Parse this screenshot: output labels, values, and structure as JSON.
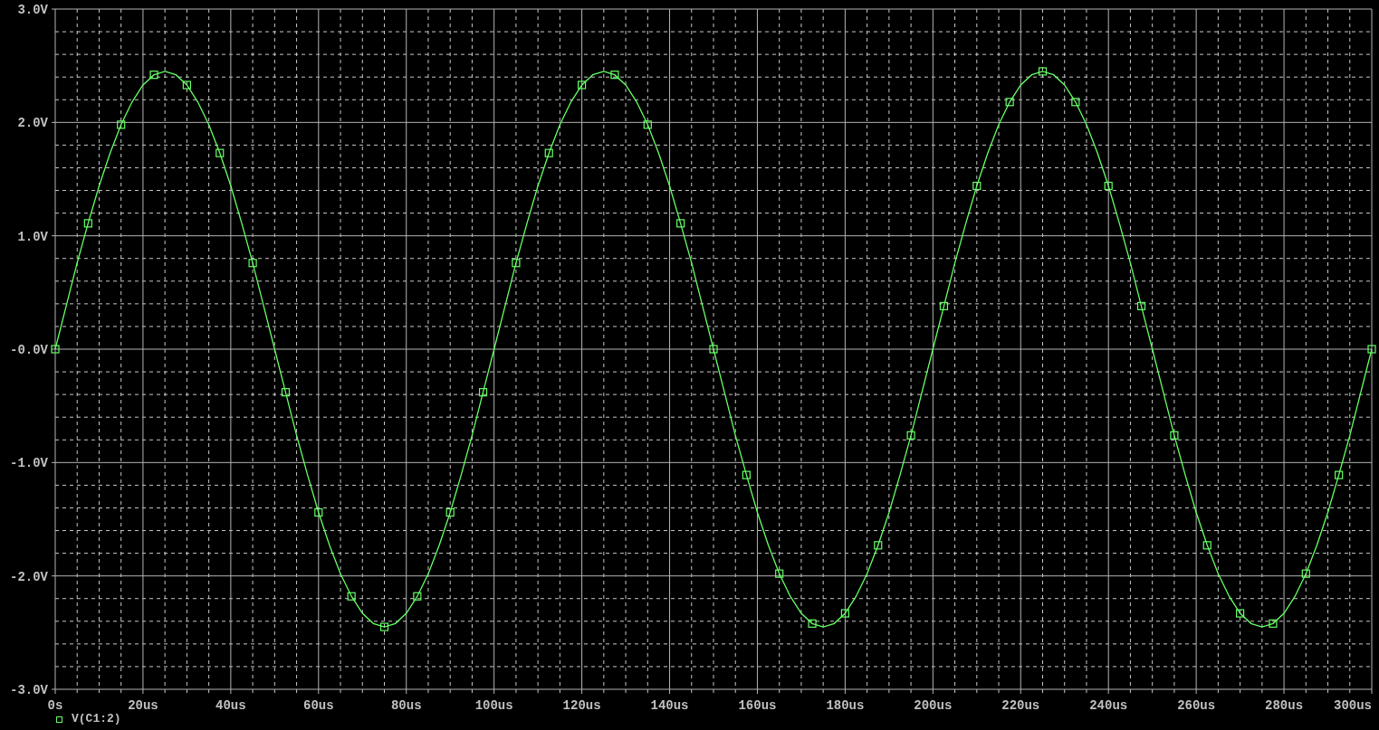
{
  "plot": {
    "chart_data": {
      "type": "line",
      "grid": true,
      "xlim": [
        0,
        300
      ],
      "ylim": [
        -3,
        3
      ],
      "xticks": [
        {
          "value": 0,
          "label": "0s"
        },
        {
          "value": 20,
          "label": "20us"
        },
        {
          "value": 40,
          "label": "40us"
        },
        {
          "value": 60,
          "label": "60us"
        },
        {
          "value": 80,
          "label": "80us"
        },
        {
          "value": 100,
          "label": "100us"
        },
        {
          "value": 120,
          "label": "120us"
        },
        {
          "value": 140,
          "label": "140us"
        },
        {
          "value": 160,
          "label": "160us"
        },
        {
          "value": 180,
          "label": "180us"
        },
        {
          "value": 200,
          "label": "200us"
        },
        {
          "value": 220,
          "label": "220us"
        },
        {
          "value": 240,
          "label": "240us"
        },
        {
          "value": 260,
          "label": "260us"
        },
        {
          "value": 280,
          "label": "280us"
        },
        {
          "value": 300,
          "label": "300us"
        }
      ],
      "yticks": [
        {
          "value": 3,
          "label": "3.0V"
        },
        {
          "value": 2,
          "label": "2.0V"
        },
        {
          "value": 1,
          "label": "1.0V"
        },
        {
          "value": 0,
          "label": "-0.0V"
        },
        {
          "value": -1,
          "label": "-1.0V"
        },
        {
          "value": -2,
          "label": "-2.0V"
        },
        {
          "value": -3,
          "label": "-3.0V"
        }
      ],
      "x": [
        0,
        2.5,
        5,
        7.5,
        10,
        12.5,
        15,
        17.5,
        20,
        22.5,
        25,
        27.5,
        30,
        32.5,
        35,
        37.5,
        40,
        42.5,
        45,
        47.5,
        50,
        52.5,
        55,
        57.5,
        60,
        62.5,
        65,
        67.5,
        70,
        72.5,
        75,
        77.5,
        80,
        82.5,
        85,
        87.5,
        90,
        92.5,
        95,
        97.5,
        100,
        102.5,
        105,
        107.5,
        110,
        112.5,
        115,
        117.5,
        120,
        122.5,
        125,
        127.5,
        130,
        132.5,
        135,
        137.5,
        140,
        142.5,
        145,
        147.5,
        150,
        152.5,
        155,
        157.5,
        160,
        162.5,
        165,
        167.5,
        170,
        172.5,
        175,
        177.5,
        180,
        182.5,
        185,
        187.5,
        190,
        192.5,
        195,
        197.5,
        200,
        202.5,
        205,
        207.5,
        210,
        212.5,
        215,
        217.5,
        220,
        222.5,
        225,
        227.5,
        230,
        232.5,
        235,
        237.5,
        240,
        242.5,
        245,
        247.5,
        250,
        252.5,
        255,
        257.5,
        260,
        262.5,
        265,
        267.5,
        270,
        272.5,
        275,
        277.5,
        280,
        282.5,
        285,
        287.5,
        290,
        292.5,
        295,
        297.5,
        300
      ],
      "series": [
        {
          "name": "V(C1:2)",
          "color": "#66ff66",
          "values": [
            0,
            0.38,
            0.76,
            1.11,
            1.44,
            1.73,
            1.98,
            2.18,
            2.33,
            2.42,
            2.45,
            2.42,
            2.33,
            2.18,
            1.98,
            1.73,
            1.44,
            1.11,
            0.76,
            0.38,
            0,
            -0.38,
            -0.76,
            -1.11,
            -1.44,
            -1.73,
            -1.98,
            -2.18,
            -2.33,
            -2.42,
            -2.45,
            -2.42,
            -2.33,
            -2.18,
            -1.98,
            -1.73,
            -1.44,
            -1.11,
            -0.76,
            -0.38,
            0,
            0.38,
            0.76,
            1.11,
            1.44,
            1.73,
            1.98,
            2.18,
            2.33,
            2.42,
            2.45,
            2.42,
            2.33,
            2.18,
            1.98,
            1.73,
            1.44,
            1.11,
            0.76,
            0.38,
            0,
            -0.38,
            -0.76,
            -1.11,
            -1.44,
            -1.73,
            -1.98,
            -2.18,
            -2.33,
            -2.42,
            -2.45,
            -2.42,
            -2.33,
            -2.18,
            -1.98,
            -1.73,
            -1.44,
            -1.11,
            -0.76,
            -0.38,
            0,
            0.38,
            0.76,
            1.11,
            1.44,
            1.73,
            1.98,
            2.18,
            2.33,
            2.42,
            2.45,
            2.42,
            2.33,
            2.18,
            1.98,
            1.73,
            1.44,
            1.11,
            0.76,
            0.38,
            0,
            -0.38,
            -0.76,
            -1.11,
            -1.44,
            -1.73,
            -1.98,
            -2.18,
            -2.33,
            -2.42,
            -2.45,
            -2.42,
            -2.33,
            -2.18,
            -1.98,
            -1.73,
            -1.44,
            -1.11,
            -0.76,
            -0.38,
            0
          ]
        }
      ]
    }
  }
}
